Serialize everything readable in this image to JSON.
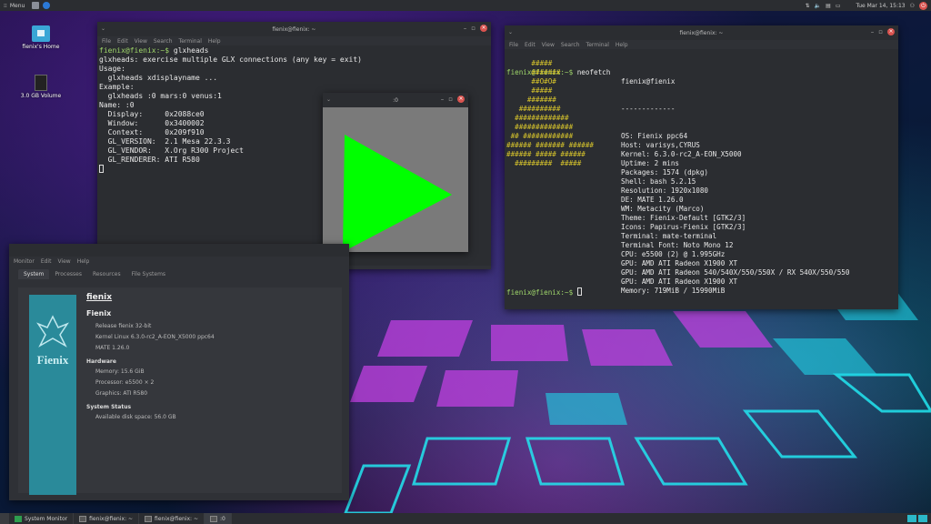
{
  "top_panel": {
    "menu_label": "Menu",
    "clock": "Tue Mar 14, 15:13"
  },
  "desktop": {
    "icons": [
      {
        "label": "fienix's Home"
      },
      {
        "label": "3.0 GB Volume"
      }
    ]
  },
  "menus": {
    "file": "File",
    "edit": "Edit",
    "view": "View",
    "search": "Search",
    "terminal": "Terminal",
    "help": "Help",
    "monitor": "Monitor"
  },
  "term1": {
    "title": "fienix@fienix: ~",
    "prompt": "fienix@fienix:~$",
    "command": " glxheads",
    "lines": [
      "glxheads: exercise multiple GLX connections (any key = exit)",
      "Usage:",
      "  glxheads xdisplayname ...",
      "Example:",
      "  glxheads :0 mars:0 venus:1",
      "Name: :0",
      "  Display:     0x2088ce0",
      "  Window:      0x3400002",
      "  Context:     0x209f910",
      "  GL_VERSION:  2.1 Mesa 22.3.3",
      "  GL_VENDOR:   X.Org R300 Project",
      "  GL_RENDERER: ATI R580"
    ]
  },
  "glx_window": {
    "title": ":0",
    "triangle_color": "#00ff00",
    "bg_color": "#7a7a7a"
  },
  "term2": {
    "title": "fienix@fienix: ~",
    "prompt": "fienix@fienix:~$",
    "command": " neofetch",
    "header": "fienix@fienix",
    "separator": "-------------",
    "ascii": [
      "      #####",
      "      #######",
      "      ##O#O#",
      "      #####",
      "     #######",
      "   ##########",
      "  #############",
      "  ##############",
      " ## ############",
      "###### ####### ######",
      "###### ##### ######",
      "  #########  #####"
    ],
    "info": [
      "OS: Fienix ppc64",
      "Host: varisys,CYRUS",
      "Kernel: 6.3.0-rc2_A-EON_X5000",
      "Uptime: 2 mins",
      "Packages: 1574 (dpkg)",
      "Shell: bash 5.2.15",
      "Resolution: 1920x1080",
      "DE: MATE 1.26.0",
      "WM: Metacity (Marco)",
      "Theme: Fienix-Default [GTK2/3]",
      "Icons: Papirus-Fienix [GTK2/3]",
      "Terminal: mate-terminal",
      "Terminal Font: Noto Mono 12",
      "CPU: e5500 (2) @ 1.995GHz",
      "GPU: AMD ATI Radeon X1900 XT",
      "GPU: AMD ATI Radeon 540/540X/550/550X / RX 540X/550/550",
      "GPU: AMD ATI Radeon X1900 XT",
      "Memory: 719MiB / 15990MiB"
    ],
    "colors": [
      "#3a3a3a",
      "#e23434",
      "#3dad3d",
      "#d9b52a",
      "#3b78c8",
      "#a05ab0",
      "#2bb8b8",
      "#e0e0e0"
    ]
  },
  "sysmon": {
    "title": "",
    "tabs": [
      "System",
      "Processes",
      "Resources",
      "File Systems"
    ],
    "logo_text": "Fienix",
    "hostname": "fienix",
    "distro": "Fienix",
    "release": "Release fienix 32-bit",
    "kernel": "Kernel Linux 6.3.0-rc2_A-EON_X5000 ppc64",
    "mate": "MATE 1.26.0",
    "hardware_label": "Hardware",
    "memory": "Memory:     15.6 GiB",
    "processor": "Processor:  e5500 × 2",
    "graphics": "Graphics:   ATI R580",
    "status_label": "System Status",
    "disk": "Available disk space:  56.0 GB"
  },
  "taskbar": [
    {
      "label": "System Monitor"
    },
    {
      "label": "fienix@fienix: ~"
    },
    {
      "label": "fienix@fienix: ~"
    },
    {
      "label": ":0"
    }
  ]
}
